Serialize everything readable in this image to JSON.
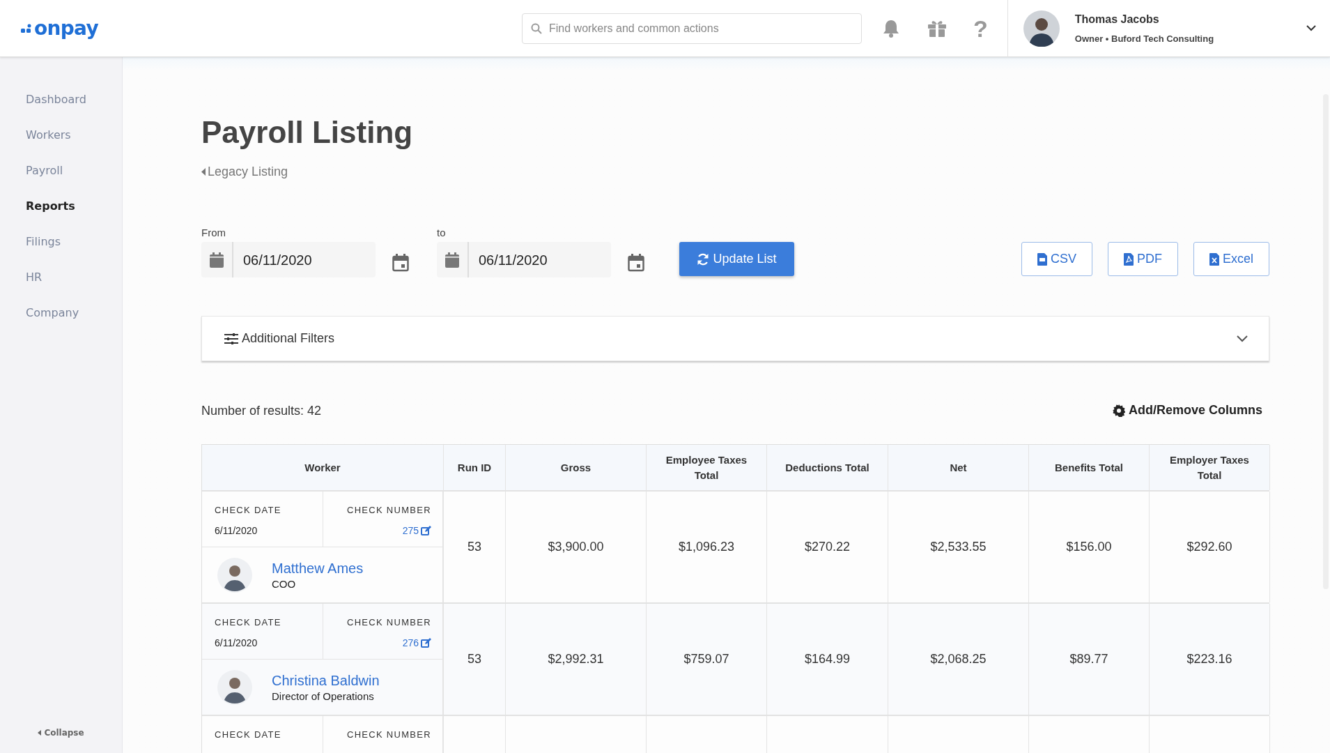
{
  "header": {
    "logo": "onpay",
    "search": {
      "placeholder": "Find workers and common actions"
    },
    "help_glyph": "?",
    "user": {
      "name": "Thomas Jacobs",
      "subtitle": "Owner • Buford Tech Consulting"
    }
  },
  "sidebar": {
    "items": [
      {
        "label": "Dashboard",
        "selected": false
      },
      {
        "label": "Workers",
        "selected": false
      },
      {
        "label": "Payroll",
        "selected": false
      },
      {
        "label": "Reports",
        "selected": true
      },
      {
        "label": "Filings",
        "selected": false
      },
      {
        "label": "HR",
        "selected": false
      },
      {
        "label": "Company",
        "selected": false
      }
    ],
    "collapse": "Collapse"
  },
  "page": {
    "title": "Payroll Listing",
    "back_link": "Legacy Listing"
  },
  "date_range": {
    "from": {
      "label": "From",
      "value": "06/11/2020"
    },
    "to": {
      "label": "to",
      "value": "06/11/2020"
    }
  },
  "update_button": "Update List",
  "exports": [
    {
      "kind": "csv",
      "label": "CSV"
    },
    {
      "kind": "pdf",
      "label": "PDF"
    },
    {
      "kind": "excel",
      "label": "Excel"
    }
  ],
  "filters": {
    "label": "Additional Filters",
    "expanded": false
  },
  "results": "Number of results: 42",
  "columns_button": "Add/Remove Columns",
  "table": {
    "columns": [
      "Worker",
      "Run ID",
      "Gross",
      "Employee Taxes Total",
      "Deductions Total",
      "Net",
      "Benefits Total",
      "Employer Taxes Total"
    ],
    "rows": [
      {
        "check_date_label": "CHECK DATE",
        "check_date": "6/11/2020",
        "check_number_label": "CHECK NUMBER",
        "check_number": "275",
        "worker": "Matthew Ames",
        "role": "COO",
        "values": [
          "53",
          "$3,900.00",
          "$1,096.23",
          "$270.22",
          "$2,533.55",
          "$156.00",
          "$292.60"
        ]
      },
      {
        "check_date_label": "CHECK DATE",
        "check_date": "6/11/2020",
        "check_number_label": "CHECK NUMBER",
        "check_number": "276",
        "worker": "Christina Baldwin",
        "role": "Director of Operations",
        "values": [
          "53",
          "$2,992.31",
          "$759.07",
          "$164.99",
          "$2,068.25",
          "$89.77",
          "$223.16"
        ]
      },
      {
        "check_date_label": "CHECK DATE",
        "check_number_label": "CHECK NUMBER"
      }
    ]
  }
}
